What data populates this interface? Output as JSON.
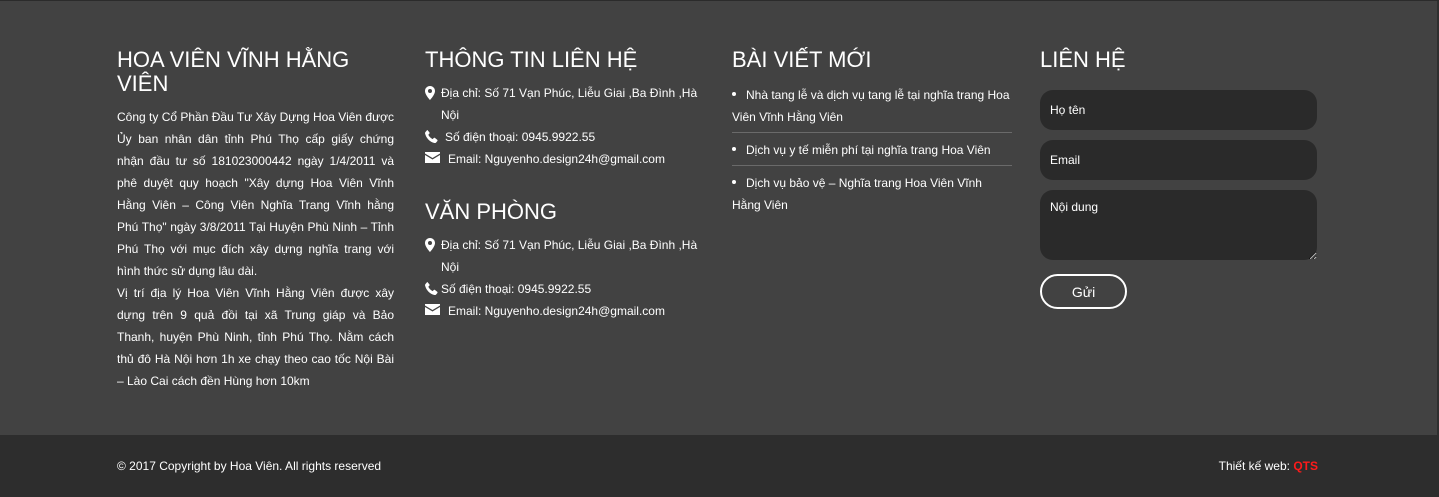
{
  "colors": {
    "background": "#424242",
    "bottom_bar": "#2d2d2d",
    "field_bg": "#2a2a2a",
    "brand_accent": "#ff1a1a"
  },
  "about": {
    "title": "HOA VIÊN VĨNH HẰNG VIÊN",
    "paragraph_1": "Công ty Cổ Phần Đầu Tư Xây Dựng Hoa Viên được Ủy ban nhân dân tỉnh Phú Thọ cấp giấy chứng nhận đầu tư số 181023000442 ngày 1/4/2011 và phê duyệt quy hoạch \"Xây dựng Hoa Viên Vĩnh Hằng Viên – Công Viên Nghĩa Trang Vĩnh hằng Phú Thọ\" ngày 3/8/2011 Tại Huyện Phù Ninh – Tỉnh Phú Thọ với mục đích xây dựng nghĩa trang với hình thức sử dụng lâu dài.",
    "paragraph_2": "Vị trí địa lý Hoa Viên Vĩnh Hằng Viên được xây dựng trên 9 quả đồi tại xã Trung giáp và Bảo Thanh, huyện Phù Ninh, tỉnh Phú Thọ. Nằm cách thủ đô Hà Nội hơn 1h xe chạy theo cao tốc Nội Bài – Lào Cai cách đền Hùng hơn 10km"
  },
  "contact_info": {
    "title": "THÔNG TIN LIÊN HỆ",
    "address": "Địa chỉ: Số 71 Vạn Phúc, Liễu Giai ,Ba Đình ,Hà Nội",
    "phone": "Số điện thoại: 0945.9922.55",
    "email": "Email: Nguyenho.design24h@gmail.com",
    "address_icon": "map-marker-icon",
    "phone_icon": "phone-icon",
    "email_icon": "envelope-icon"
  },
  "office": {
    "title": "VĂN PHÒNG",
    "address": "Địa chỉ: Số 71 Vạn Phúc, Liễu Giai ,Ba Đình ,Hà Nội",
    "phone": "Số điện thoại: 0945.9922.55",
    "email": "Email: Nguyenho.design24h@gmail.com"
  },
  "recent_posts": {
    "title": "BÀI VIẾT MỚI",
    "items": [
      "Nhà tang lễ và dịch vụ tang lễ tại nghĩa trang Hoa Viên Vĩnh Hằng Viên",
      "Dịch vụ y tế miễn phí tại nghĩa trang Hoa Viên",
      "Dịch vụ bảo vệ – Nghĩa trang Hoa Viên Vĩnh Hằng Viên"
    ]
  },
  "contact_form": {
    "title": "LIÊN HỆ",
    "name_placeholder": "Họ tên",
    "email_placeholder": "Email",
    "message_placeholder": "Nội dung",
    "submit_label": "Gửi"
  },
  "bottom_bar": {
    "copyright": "© 2017 Copyright by Hoa Viên. All rights reserved",
    "design_label": "Thiết kế web: ",
    "design_brand": "QTS"
  }
}
